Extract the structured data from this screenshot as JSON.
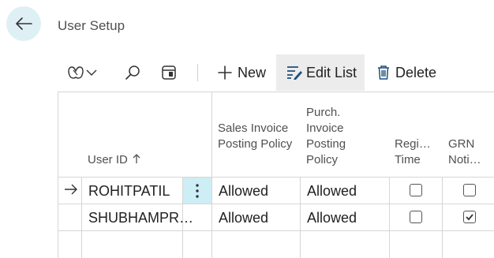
{
  "page": {
    "title": "User Setup"
  },
  "toolbar": {
    "new_label": "New",
    "edit_list_label": "Edit List",
    "delete_label": "Delete"
  },
  "columns": {
    "user_id": "User ID",
    "sales_invoice": "Sales Invoice Posting Policy",
    "purch_invoice": "Purch. Invoice Posting Policy",
    "register_time": "Regi… Time",
    "grn": "GRN Noti…"
  },
  "rows": [
    {
      "user_id": "ROHITPATIL",
      "sales_invoice": "Allowed",
      "purch_invoice": "Allowed",
      "register_time": false,
      "grn": false
    },
    {
      "user_id": "SHUBHAMPR…",
      "sales_invoice": "Allowed",
      "purch_invoice": "Allowed",
      "register_time": false,
      "grn": true
    }
  ],
  "colors": {
    "accent": "#cdeef4",
    "back_bg": "#dff0f5"
  },
  "icons": [
    "back-arrow-icon",
    "copilot-icon",
    "chevron-down-icon",
    "search-icon",
    "filter-pane-icon",
    "plus-icon",
    "edit-list-icon",
    "delete-icon",
    "sort-up-icon",
    "row-arrow-icon",
    "more-options-icon"
  ]
}
